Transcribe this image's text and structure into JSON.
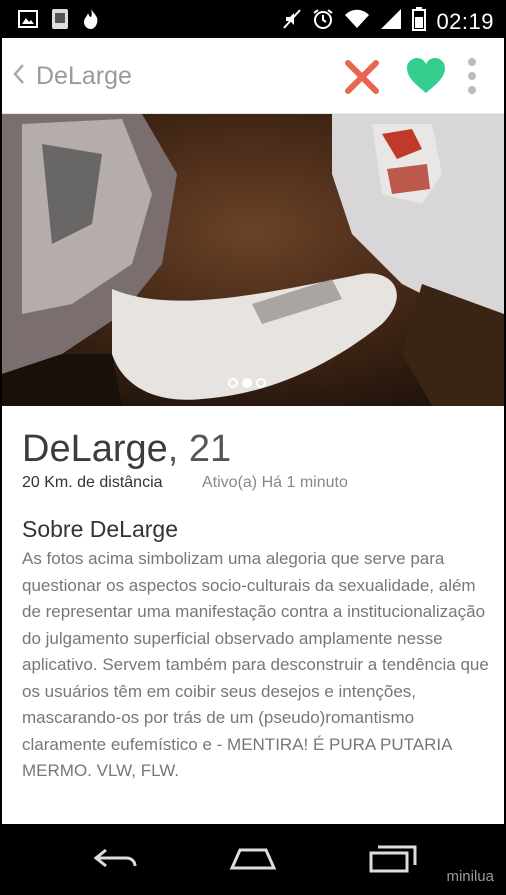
{
  "status": {
    "time": "02:19"
  },
  "appbar": {
    "title": "DeLarge"
  },
  "profile": {
    "name": "DeLarge",
    "age": ", 21",
    "distance": "20 Km. de distância",
    "active": "Ativo(a) Há 1 minuto",
    "photo_pages": 3,
    "photo_current": 2
  },
  "about": {
    "title": "Sobre DeLarge",
    "text": "As fotos acima simbolizam uma alegoria que serve para questionar os aspectos socio-culturais da sexualidade, além de representar uma manifestação contra a institucionalização do julgamento superficial observado amplamente nesse aplicativo. Servem também para desconstruir a tendência que os usuários têm em coibir seus desejos e intenções, mascarando-os por trás de um (pseudo)romantismo claramente eufemístico e - MENTIRA! É PURA PUTARIA MERMO. VLW, FLW."
  },
  "watermark": "minilua",
  "colors": {
    "reject": "#e8664f",
    "like": "#34cf8e"
  },
  "icons": [
    "image-icon",
    "app-icon",
    "tinder-flame-icon",
    "mute-icon",
    "alarm-icon",
    "wifi-icon",
    "signal-icon",
    "battery-icon",
    "back-icon",
    "reject-x-icon",
    "like-heart-icon",
    "more-vert-icon",
    "nav-back-icon",
    "nav-home-icon",
    "nav-recents-icon"
  ]
}
